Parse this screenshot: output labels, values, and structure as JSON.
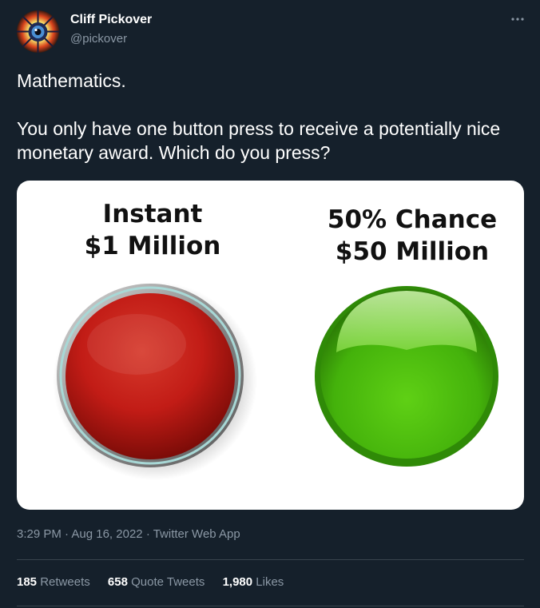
{
  "author": {
    "name": "Cliff Pickover",
    "handle": "@pickover"
  },
  "tweet": {
    "lines": [
      "Mathematics.",
      "You only have one button press to receive a potentially nice monetary award.   Which do you press?"
    ]
  },
  "media": {
    "left_option": {
      "line1": "Instant",
      "line2": "$1 Million",
      "button_color": "#c41d17"
    },
    "right_option": {
      "line1": "50% Chance",
      "line2": "$50 Million",
      "button_color": "#5fcf14"
    }
  },
  "meta": {
    "time": "3:29 PM",
    "date": "Aug 16, 2022",
    "source": "Twitter Web App",
    "separator": "·"
  },
  "stats": {
    "retweets": {
      "count": "185",
      "label": "Retweets"
    },
    "quote_tweets": {
      "count": "658",
      "label": "Quote Tweets"
    },
    "likes": {
      "count": "1,980",
      "label": "Likes"
    }
  },
  "colors": {
    "background": "#15202b",
    "text_secondary": "#8b98a5",
    "divider": "#38444d"
  },
  "icons": {
    "more": "more-horizontal-icon",
    "avatar": "fractal-eye-avatar"
  }
}
